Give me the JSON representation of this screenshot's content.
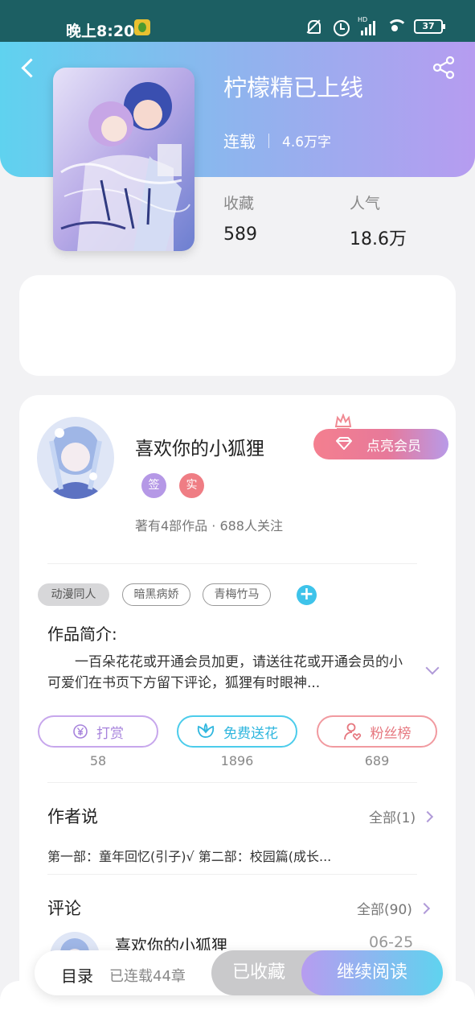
{
  "status_bar": {
    "time": "晚上8:20",
    "network": "HD",
    "battery": "37"
  },
  "book": {
    "title": "柠檬精已上线",
    "status": "连载",
    "word_count": "4.6万字",
    "favorites_label": "收藏",
    "favorites_value": "589",
    "popularity_label": "人气",
    "popularity_value": "18.6万"
  },
  "author": {
    "name": "喜欢你的小狐狸",
    "member_button": "点亮会员",
    "badge_signed": "签",
    "badge_real": "实",
    "stats": "著有4部作品 · 688人关注"
  },
  "tags": [
    "动漫同人",
    "暗黑病娇",
    "青梅竹马"
  ],
  "tag_add": "+",
  "intro": {
    "heading": "作品简介:",
    "text": "一百朵花花或开通会员加更，请送往花或开通会员的小可爱们在书页下方留下评论，狐狸有时眼神..."
  },
  "actions": {
    "tip_label": "打赏",
    "tip_count": "58",
    "flower_label": "免费送花",
    "flower_count": "1896",
    "fans_label": "粉丝榜",
    "fans_count": "689"
  },
  "author_says": {
    "heading": "作者说",
    "more": "全部(1)",
    "text": "第一部：童年回忆(引子)√ 第二部：校园篇(成长..."
  },
  "comments": {
    "heading": "评论",
    "more": "全部(90)",
    "first_user": "喜欢你的小狐狸",
    "first_date": "06-25"
  },
  "bottom_bar": {
    "catalog": "目录",
    "chapters": "已连载44章",
    "collected": "已收藏",
    "continue": "继续阅读"
  },
  "colors": {
    "header_gradient_start": "#5fd2ef",
    "header_gradient_end": "#b69cf0",
    "accent_purple": "#b09ad8",
    "accent_cyan": "#3ec3ea",
    "accent_pink": "#ef7d84"
  }
}
